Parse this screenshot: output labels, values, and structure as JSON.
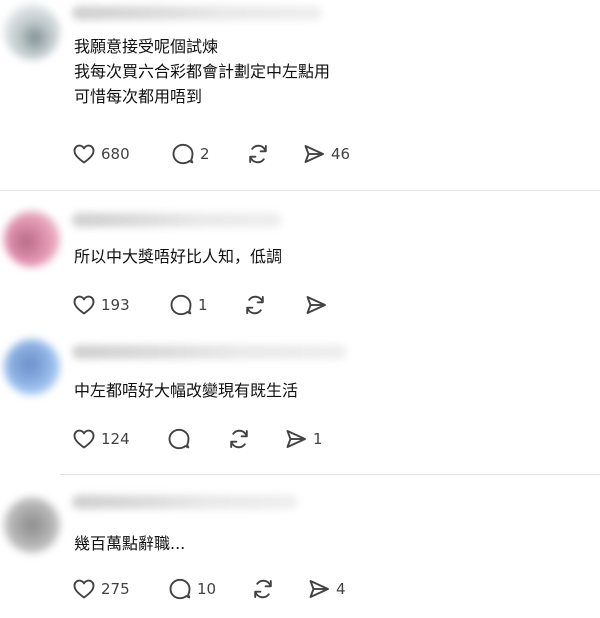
{
  "comments": [
    {
      "lines": [
        "我願意接受呢個試煉",
        "我每次買六合彩都會計劃定中左點用",
        "可惜每次都用唔到"
      ],
      "likes": "680",
      "replies": "2",
      "reposts": "",
      "shares": "46",
      "avatar_colors": [
        "#dfe4e6",
        "#7b8a8f"
      ]
    },
    {
      "lines": [
        "所以中大獎唔好比人知，低調"
      ],
      "likes": "193",
      "replies": "1",
      "reposts": "",
      "shares": "",
      "avatar_colors": [
        "#e8a7bd",
        "#b46a86"
      ]
    },
    {
      "lines": [
        "中左都唔好大幅改變現有既生活"
      ],
      "likes": "124",
      "replies": "",
      "reposts": "",
      "shares": "1",
      "avatar_colors": [
        "#9ec3ef",
        "#6d8fc9"
      ]
    },
    {
      "lines": [
        "幾百萬點辭職..."
      ],
      "likes": "275",
      "replies": "10",
      "reposts": "",
      "shares": "4",
      "avatar_colors": [
        "#bdbdbd",
        "#8d8d8d"
      ]
    }
  ],
  "icons": {
    "like": "heart-icon",
    "reply": "speech-bubble-icon",
    "repost": "repost-icon",
    "share": "paper-plane-icon"
  },
  "colors": {
    "text": "#101010",
    "icon": "#424242",
    "divider": "#e3e3e3"
  }
}
